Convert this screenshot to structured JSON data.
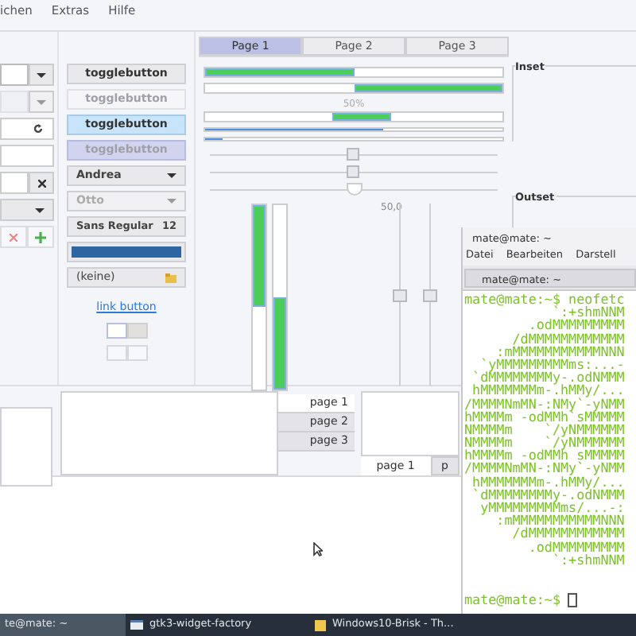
{
  "menubar": {
    "items": [
      "ichen",
      "Extras",
      "Hilfe"
    ]
  },
  "entries": [
    {
      "kind": "combo",
      "disabled": false
    },
    {
      "kind": "combo",
      "disabled": true
    },
    {
      "kind": "refresh"
    },
    {
      "kind": "plain"
    },
    {
      "kind": "clear"
    },
    {
      "kind": "dropdown"
    },
    {
      "kind": "pair"
    }
  ],
  "togglebuttons": [
    {
      "label": "togglebutton",
      "active": false,
      "disabled": false
    },
    {
      "label": "togglebutton",
      "active": false,
      "disabled": true
    },
    {
      "label": "togglebutton",
      "active": true,
      "disabled": false
    },
    {
      "label": "togglebutton",
      "active": true,
      "disabled": true
    }
  ],
  "combos": [
    {
      "value": "Andrea",
      "disabled": false
    },
    {
      "value": "Otto",
      "disabled": true
    }
  ],
  "font_button": {
    "family": "Sans Regular",
    "size": "12"
  },
  "file_button": {
    "label": "(keine)"
  },
  "link_button": {
    "label": "link button"
  },
  "toggle_groups": [
    [
      {
        "active": false
      },
      {
        "active": true
      }
    ],
    [
      {
        "active": false
      },
      {
        "active": false
      }
    ]
  ],
  "notebook": {
    "tabs": [
      {
        "label": "Page 1",
        "selected": true
      },
      {
        "label": "Page 2",
        "selected": false
      },
      {
        "label": "Page 3",
        "selected": false
      }
    ]
  },
  "progress_bars": [
    {
      "kind": "normal",
      "level": 0.5
    },
    {
      "kind": "inverted",
      "level": 0.5
    },
    {
      "kind": "pulse",
      "text": "50%"
    },
    {
      "kind": "thin",
      "level": 0.6
    },
    {
      "kind": "steps",
      "level": 0.06
    }
  ],
  "sliders": [
    {
      "kind": "square",
      "level": 0.5
    },
    {
      "kind": "square",
      "level": 0.5
    },
    {
      "kind": "round",
      "level": 0.5,
      "mark": "50,0"
    }
  ],
  "vertical_bars": [
    {
      "level": 0.55,
      "inverted": true
    },
    {
      "level": 0.5,
      "inverted": false
    }
  ],
  "vertical_sliders": [
    {
      "level": 0.5
    },
    {
      "level": 0.5
    }
  ],
  "frames": [
    {
      "label": "Inset"
    },
    {
      "label": "Outset"
    }
  ],
  "side_tabs": [
    {
      "label": "page 1",
      "selected": true
    },
    {
      "label": "page 2",
      "selected": false
    },
    {
      "label": "page 3",
      "selected": false
    }
  ],
  "bottom_tabs": [
    {
      "label": "page 1",
      "selected": true
    },
    {
      "label": "p",
      "selected": false
    }
  ],
  "terminal": {
    "title": "mate@mate: ~",
    "menu": [
      "Datei",
      "Bearbeiten",
      "Darstell"
    ],
    "tab": "mate@mate: ~",
    "lines": [
      "mate@mate:~$ neofetc",
      "           `:+shmNNM",
      "        .odMMMMMMMMM",
      "      /dMMMMMMMMMMMM",
      "    :mMMMMMMMMMMMNNN",
      "  `yMMMMMMMMMms:...-",
      " `dMMMMMMMMy-.odNMMM",
      " hMMMMMMMm-.hMMy/...",
      "/MMMMNmMN-:NMy`-yNMM",
      "hMMMMm -odMMh`sMMMMM",
      "NMMMMm    `/yNMMMMMM",
      "NMMMMm    `/yNMMMMMM",
      "hMMMMm -odMMh sMMMMM",
      "/MMMMNmMN-:NMy`-yNMM",
      " hMMMMMMMm-.hMMy/...",
      " `dMMMMMMMMy-.odNMMM",
      "  yMMMMMMMMMms/...-:",
      "    :mMMMMMMMMMMMNNN",
      "      /dMMMMMMMMMMMM",
      "        .odMMMMMMMMM",
      "           `:+shmNNM"
    ],
    "prompt": "mate@mate:~$"
  },
  "taskbar": [
    {
      "label": "te@mate: ~",
      "selected": true,
      "kind": "none"
    },
    {
      "label": "gtk3-widget-factory",
      "selected": false,
      "kind": "window"
    },
    {
      "label": "Windows10-Brisk - Th...",
      "selected": false,
      "kind": "folder"
    }
  ]
}
